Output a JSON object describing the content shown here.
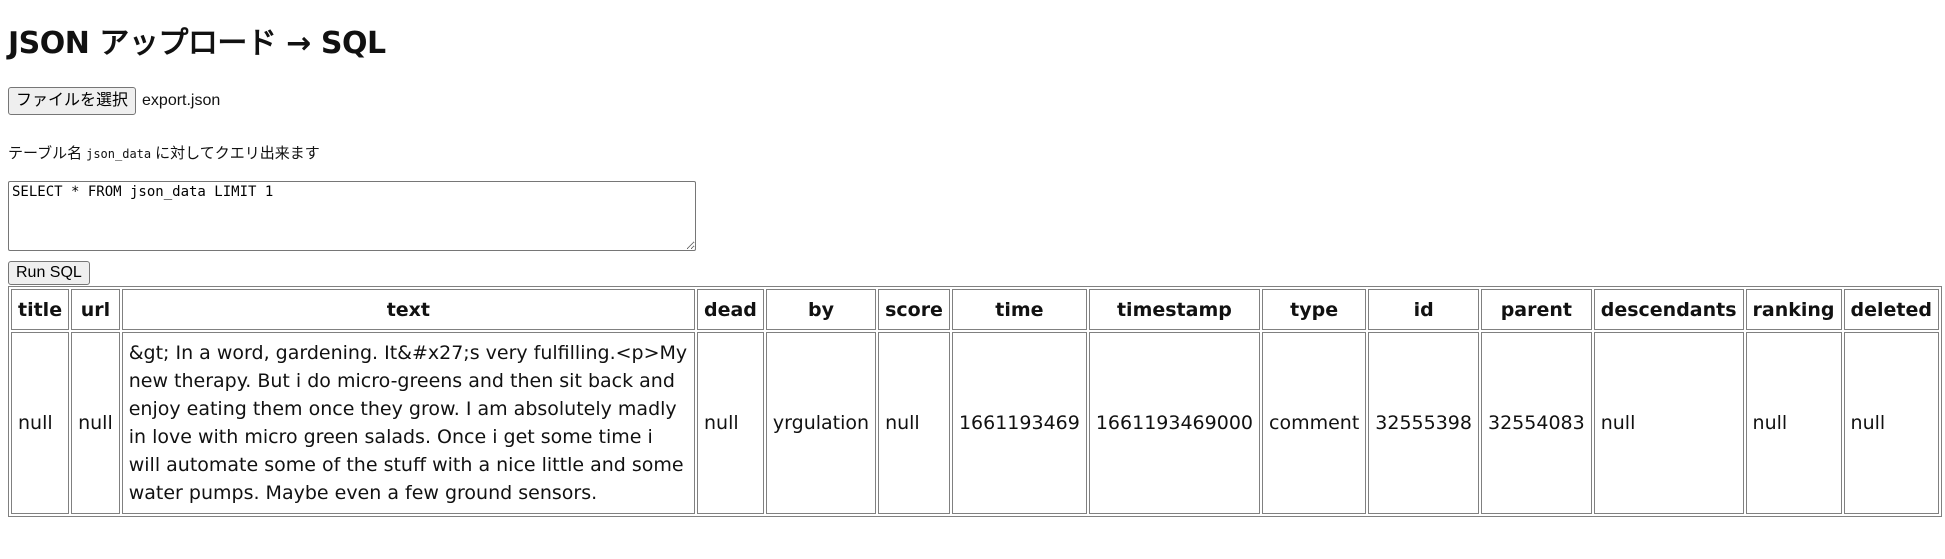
{
  "page": {
    "title": "JSON アップロード → SQL"
  },
  "file": {
    "button_label": "ファイルを選択",
    "file_name": "export.json"
  },
  "hint": {
    "prefix": "テーブル名",
    "table_name": "json_data",
    "suffix": "に対してクエリ出来ます"
  },
  "query": {
    "value": "SELECT * FROM json_data LIMIT 1"
  },
  "run": {
    "label": "Run SQL"
  },
  "results": {
    "columns": [
      "title",
      "url",
      "text",
      "dead",
      "by",
      "score",
      "time",
      "timestamp",
      "type",
      "id",
      "parent",
      "descendants",
      "ranking",
      "deleted"
    ],
    "rows": [
      {
        "title": "null",
        "url": "null",
        "text": "&gt; In a word, gardening. It&#x27;s very fulfilling.<p>My new therapy. But i do micro-greens and then sit back and enjoy eating them once they grow. I am absolutely madly in love with micro green salads. Once i get some time i will automate some of the stuff with a nice little and some water pumps. Maybe even a few ground sensors.",
        "dead": "null",
        "by": "yrgulation",
        "score": "null",
        "time": "1661193469",
        "timestamp": "1661193469000",
        "type": "comment",
        "id": "32555398",
        "parent": "32554083",
        "descendants": "null",
        "ranking": "null",
        "deleted": "null"
      }
    ]
  }
}
